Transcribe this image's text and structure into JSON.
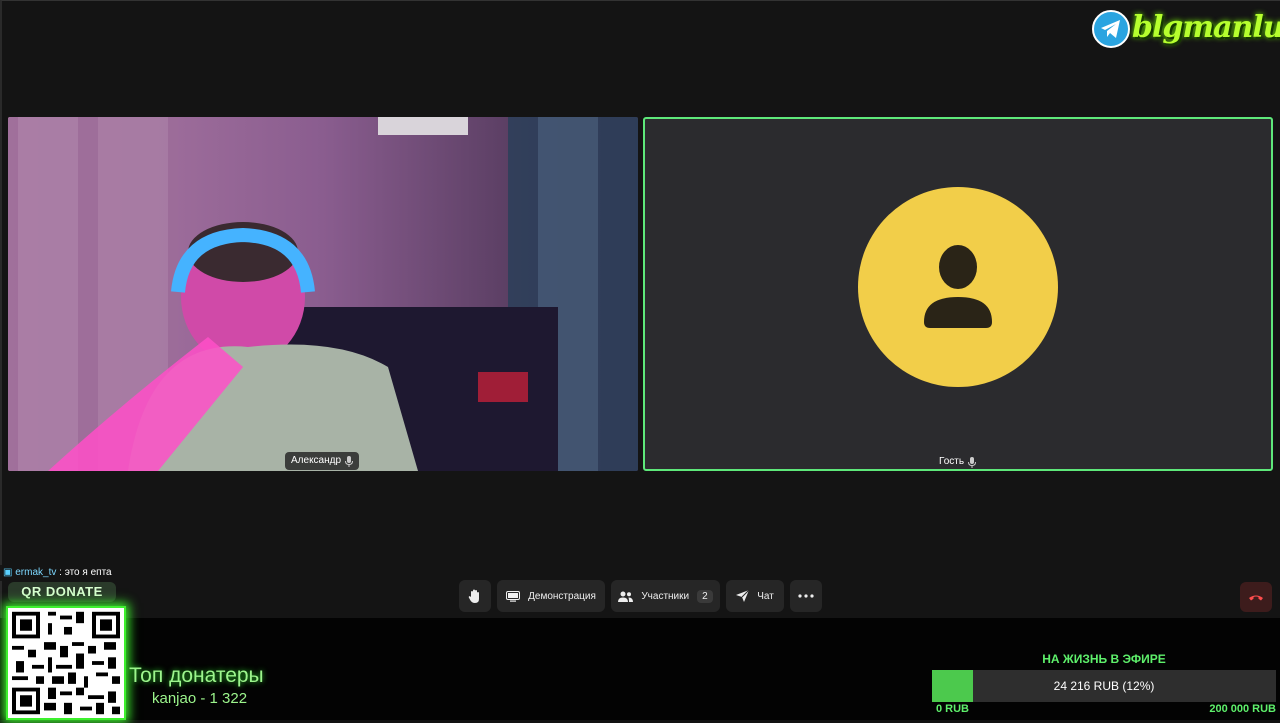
{
  "brand": {
    "logo_text": "blgmanlu",
    "logo_icon": "telegram-icon"
  },
  "participants": [
    {
      "name": "Александр",
      "mic_icon": "mic-icon"
    },
    {
      "name": "Гость",
      "mic_icon": "mic-icon",
      "avatar_icon": "user-icon",
      "avatar_color": "#f2ce49",
      "active_border_color": "#5ee87a"
    }
  ],
  "toolbar": {
    "raise_hand_icon": "hand-icon",
    "screen_share_label": "Демонстрация",
    "participants_label": "Участники",
    "participants_count": "2",
    "chat_label": "Чат",
    "more_icon": "more-icon",
    "end_call_icon": "phone-hangup-icon"
  },
  "chat_overlay": {
    "user": "ermak_tv",
    "separator": ":",
    "message": "это я епта"
  },
  "donate": {
    "qr_label": "QR DONATE",
    "top_title": "Топ донатеры",
    "top_entry": "kanjao - 1 322"
  },
  "goal": {
    "title": "НА ЖИЗНЬ В ЭФИРЕ",
    "amount_text": "24 216 RUB (12%)",
    "progress_percent": 12,
    "min_label": "0 RUB",
    "max_label": "200 000 RUB",
    "fill_color": "#4cc94d"
  }
}
